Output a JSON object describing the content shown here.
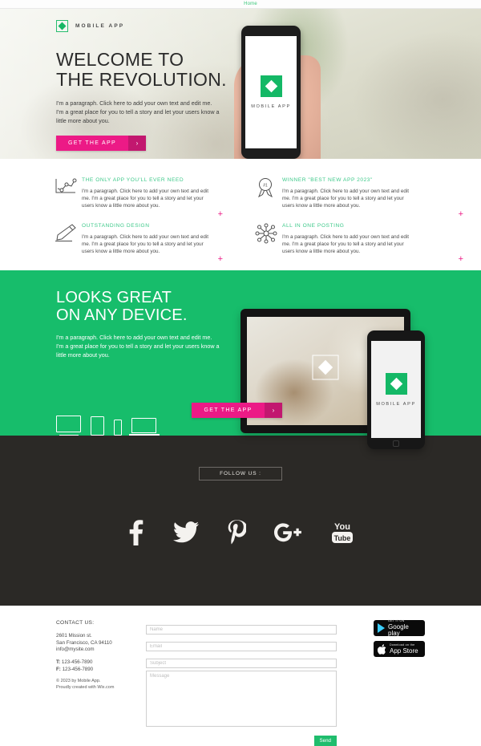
{
  "nav": {
    "home": "Home"
  },
  "brand": {
    "name": "MOBILE APP",
    "logo_icon": "diamond-logo-icon"
  },
  "hero": {
    "heading_line1": "WELCOME TO",
    "heading_line2": "THE REVOLUTION.",
    "paragraph": "I'm a paragraph. Click here to add your own text and edit me. I'm a great place for you to tell a story and let your users know a little more about you.",
    "cta_label": "GET THE APP",
    "cta_arrow": "›",
    "phone_app_name": "MOBILE APP"
  },
  "features": [
    {
      "icon": "line-chart-icon",
      "title": "THE ONLY APP YOU'LL EVER NEED",
      "text": "I'm a paragraph. Click here to add your own text and edit me. I'm a great place for you to tell a story and let your users know a little more about you.",
      "plus": "+"
    },
    {
      "icon": "award-ribbon-icon",
      "title": "WINNER \"BEST NEW APP 2023\"",
      "text": "I'm a paragraph. Click here to add your own text and edit me. I'm a great place for you to tell a story and let your users know a little more about you.",
      "plus": "+"
    },
    {
      "icon": "pencil-icon",
      "title": "OUTSTANDING DESIGN",
      "text": "I'm a paragraph. Click here to add your own text and edit me. I'm a great place for you to tell a story and let your users know a little more about you.",
      "plus": "+"
    },
    {
      "icon": "share-network-icon",
      "title": "ALL IN ONE POSTING",
      "text": "I'm a paragraph. Click here to add your own text and edit me. I'm a great place for you to tell a story and let your users know a little more about you.",
      "plus": "+"
    }
  ],
  "devices_section": {
    "heading_line1": "LOOKS GREAT",
    "heading_line2": "ON ANY DEVICE.",
    "paragraph": "I'm a paragraph. Click here to add your own text and edit me. I'm a great place for you to tell a story and let your users know a little more about you.",
    "cta_label": "GET THE APP",
    "cta_arrow": "›",
    "phone_app_name": "MOBILE APP",
    "device_icons": [
      "desktop-monitor-icon",
      "tablet-icon",
      "smartphone-icon",
      "laptop-icon"
    ]
  },
  "social": {
    "follow_label": "FOLLOW US :",
    "items": [
      {
        "icon": "facebook-icon",
        "glyph": "f"
      },
      {
        "icon": "twitter-icon",
        "glyph": "t"
      },
      {
        "icon": "pinterest-icon",
        "glyph": "P"
      },
      {
        "icon": "google-plus-icon",
        "glyph": "g+"
      },
      {
        "icon": "youtube-icon",
        "glyph": "You Tube"
      }
    ]
  },
  "contact": {
    "title": "CONTACT US:",
    "address_line1": "2601 Mission st.",
    "address_line2": "San Francisco, CA 94110",
    "email": "info@mysite.com",
    "phone_label": "T:",
    "phone": "123-456-7890",
    "fax_label": "F:",
    "fax": "123-456-7890",
    "copyright_line1": "© 2023 by Mobile App.",
    "copyright_line2": "Proudly created with Wix.com"
  },
  "form": {
    "name_placeholder": "Name",
    "email_placeholder": "Email",
    "subject_placeholder": "Subject",
    "message_placeholder": "Message",
    "send_label": "Send",
    "name_value": "",
    "email_value": "",
    "subject_value": "",
    "message_value": ""
  },
  "store_badges": [
    {
      "icon": "google-play-icon",
      "small": "GET IT ON",
      "big": "Google play"
    },
    {
      "icon": "apple-icon",
      "small": "Download on the",
      "big": "App Store"
    }
  ],
  "colors": {
    "green": "#17bd6b",
    "pink": "#ec1a86",
    "pink_dark": "#c2176f",
    "dark": "#2b2926",
    "heading_green": "#3ec98a"
  }
}
